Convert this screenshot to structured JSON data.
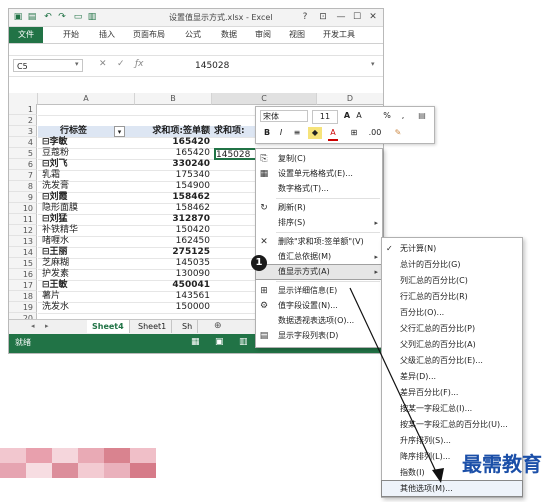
{
  "window": {
    "title": "设置值显示方式.xlsx - Excel",
    "controls": [
      "?",
      "⊡",
      "—",
      "☐",
      "✕"
    ]
  },
  "ribbon": {
    "tabs": [
      "文件",
      "开始",
      "插入",
      "页面布局",
      "公式",
      "数据",
      "审阅",
      "视图",
      "开发工具"
    ]
  },
  "formula_bar": {
    "name_box": "C5",
    "formula": "145028"
  },
  "columns": [
    "A",
    "B",
    "C",
    "D"
  ],
  "row_numbers": [
    "1",
    "2",
    "3",
    "4",
    "5",
    "6",
    "7",
    "8",
    "9",
    "10",
    "11",
    "12",
    "13",
    "14",
    "15",
    "16",
    "17",
    "18",
    "19",
    "20"
  ],
  "pivot": {
    "header": {
      "a": "行标签",
      "b": "求和项:签单额",
      "c": "求和项:"
    },
    "rows": [
      {
        "a": "⊟李敏",
        "b": "165420",
        "bold": true
      },
      {
        "a": "    豆蔻粉",
        "b": "165420",
        "bold": false
      },
      {
        "a": "⊟刘飞",
        "b": "330240",
        "bold": true
      },
      {
        "a": "    乳霜",
        "b": "175340",
        "bold": false
      },
      {
        "a": "    洗发膏",
        "b": "154900",
        "bold": false
      },
      {
        "a": "⊟刘霞",
        "b": "158462",
        "bold": true
      },
      {
        "a": "    隐形面膜",
        "b": "158462",
        "bold": false
      },
      {
        "a": "⊟刘猛",
        "b": "312870",
        "bold": true
      },
      {
        "a": "    补铁精华",
        "b": "150420",
        "bold": false
      },
      {
        "a": "    啫喱水",
        "b": "162450",
        "bold": false
      },
      {
        "a": "⊟王丽",
        "b": "275125",
        "bold": true
      },
      {
        "a": "    芝麻糊",
        "b": "145035",
        "bold": false
      },
      {
        "a": "    护发素",
        "b": "130090",
        "bold": false
      },
      {
        "a": "⊟王敏",
        "b": "450041",
        "bold": true
      },
      {
        "a": "    薯片",
        "b": "143561",
        "bold": false
      },
      {
        "a": "    洗发水",
        "b": "150000",
        "bold": false
      }
    ],
    "c_cell_text": "145028"
  },
  "sheet_tabs": [
    "Sheet4",
    "Sheet1",
    "Sh"
  ],
  "status": {
    "ready": "就绪"
  },
  "mini_toolbar": {
    "font": "宋体",
    "size": "11",
    "row1_icons": [
      "A",
      "A",
      "%",
      ","
    ],
    "row2_icons": [
      "B",
      "I",
      "≡",
      "A",
      "⊞",
      ".00"
    ]
  },
  "context_menu": {
    "items": [
      {
        "icon": "⎘",
        "label": "复制(C)",
        "arrow": ""
      },
      {
        "icon": "▦",
        "label": "设置单元格格式(E)...",
        "arrow": ""
      },
      {
        "icon": "",
        "label": "数字格式(T)...",
        "arrow": ""
      },
      {
        "icon": "↻",
        "label": "刷新(R)",
        "arrow": ""
      },
      {
        "icon": "",
        "label": "排序(S)",
        "arrow": "▸"
      },
      {
        "icon": "✕",
        "label": "删除\"求和项:签单额\"(V)",
        "arrow": ""
      },
      {
        "icon": "",
        "label": "值汇总依据(M)",
        "arrow": "▸"
      },
      {
        "icon": "",
        "label": "值显示方式(A)",
        "arrow": "▸"
      },
      {
        "icon": "⊞",
        "label": "显示详细信息(E)",
        "arrow": ""
      },
      {
        "icon": "⚙",
        "label": "值字段设置(N)...",
        "arrow": ""
      },
      {
        "icon": "",
        "label": "数据透视表选项(O)...",
        "arrow": ""
      },
      {
        "icon": "▤",
        "label": "显示字段列表(D)",
        "arrow": ""
      }
    ]
  },
  "submenu": {
    "items": [
      {
        "check": "✓",
        "label": "无计算(N)"
      },
      {
        "check": "",
        "label": "总计的百分比(G)"
      },
      {
        "check": "",
        "label": "列汇总的百分比(C)"
      },
      {
        "check": "",
        "label": "行汇总的百分比(R)"
      },
      {
        "check": "",
        "label": "百分比(O)..."
      },
      {
        "check": "",
        "label": "父行汇总的百分比(P)"
      },
      {
        "check": "",
        "label": "父列汇总的百分比(A)"
      },
      {
        "check": "",
        "label": "父级汇总的百分比(E)..."
      },
      {
        "check": "",
        "label": "差异(D)..."
      },
      {
        "check": "",
        "label": "差异百分比(F)..."
      },
      {
        "check": "",
        "label": "按某一字段汇总(I)..."
      },
      {
        "check": "",
        "label": "按某一字段汇总的百分比(U)..."
      },
      {
        "check": "",
        "label": "升序排列(S)..."
      },
      {
        "check": "",
        "label": "降序排列(L)..."
      },
      {
        "check": "",
        "label": "指数(I)"
      },
      {
        "check": "",
        "label": "其他选项(M)..."
      }
    ]
  },
  "callout": {
    "number": "1"
  },
  "watermark": {
    "text": "最需教育"
  },
  "colors": {
    "excel_green": "#217346",
    "pivot_header": "#dde6f3",
    "brand_blue": "#1b4fa8"
  }
}
